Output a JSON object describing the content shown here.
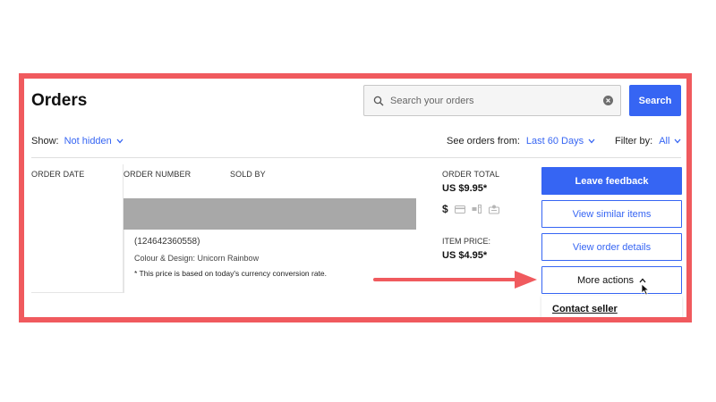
{
  "page": {
    "title": "Orders"
  },
  "search": {
    "placeholder": "Search your orders",
    "button_label": "Search"
  },
  "filters": {
    "show_label": "Show:",
    "show_value": "Not hidden",
    "orders_from_label": "See orders from:",
    "orders_from_value": "Last 60 Days",
    "filter_label": "Filter by:",
    "filter_value": "All"
  },
  "columns": {
    "order_date": "ORDER DATE",
    "order_number": "ORDER NUMBER",
    "sold_by": "SOLD BY",
    "order_total": "ORDER TOTAL"
  },
  "order": {
    "total": "US $9.95*",
    "item_id": "(124642360558)",
    "variant": "Colour & Design: Unicorn Rainbow",
    "note": "* This price is based on today's currency conversion rate.",
    "item_price_label": "ITEM PRICE:",
    "item_price": "US $4.95*",
    "status_icons": [
      "dollar-icon",
      "card-icon",
      "shipped-icon",
      "feedback-icon"
    ]
  },
  "actions": {
    "leave_feedback": "Leave feedback",
    "view_similar": "View similar items",
    "view_details": "View order details",
    "more_actions": "More actions",
    "contact_seller": "Contact seller"
  },
  "colors": {
    "accent": "#3665f3",
    "annotation": "#f05a5e"
  }
}
